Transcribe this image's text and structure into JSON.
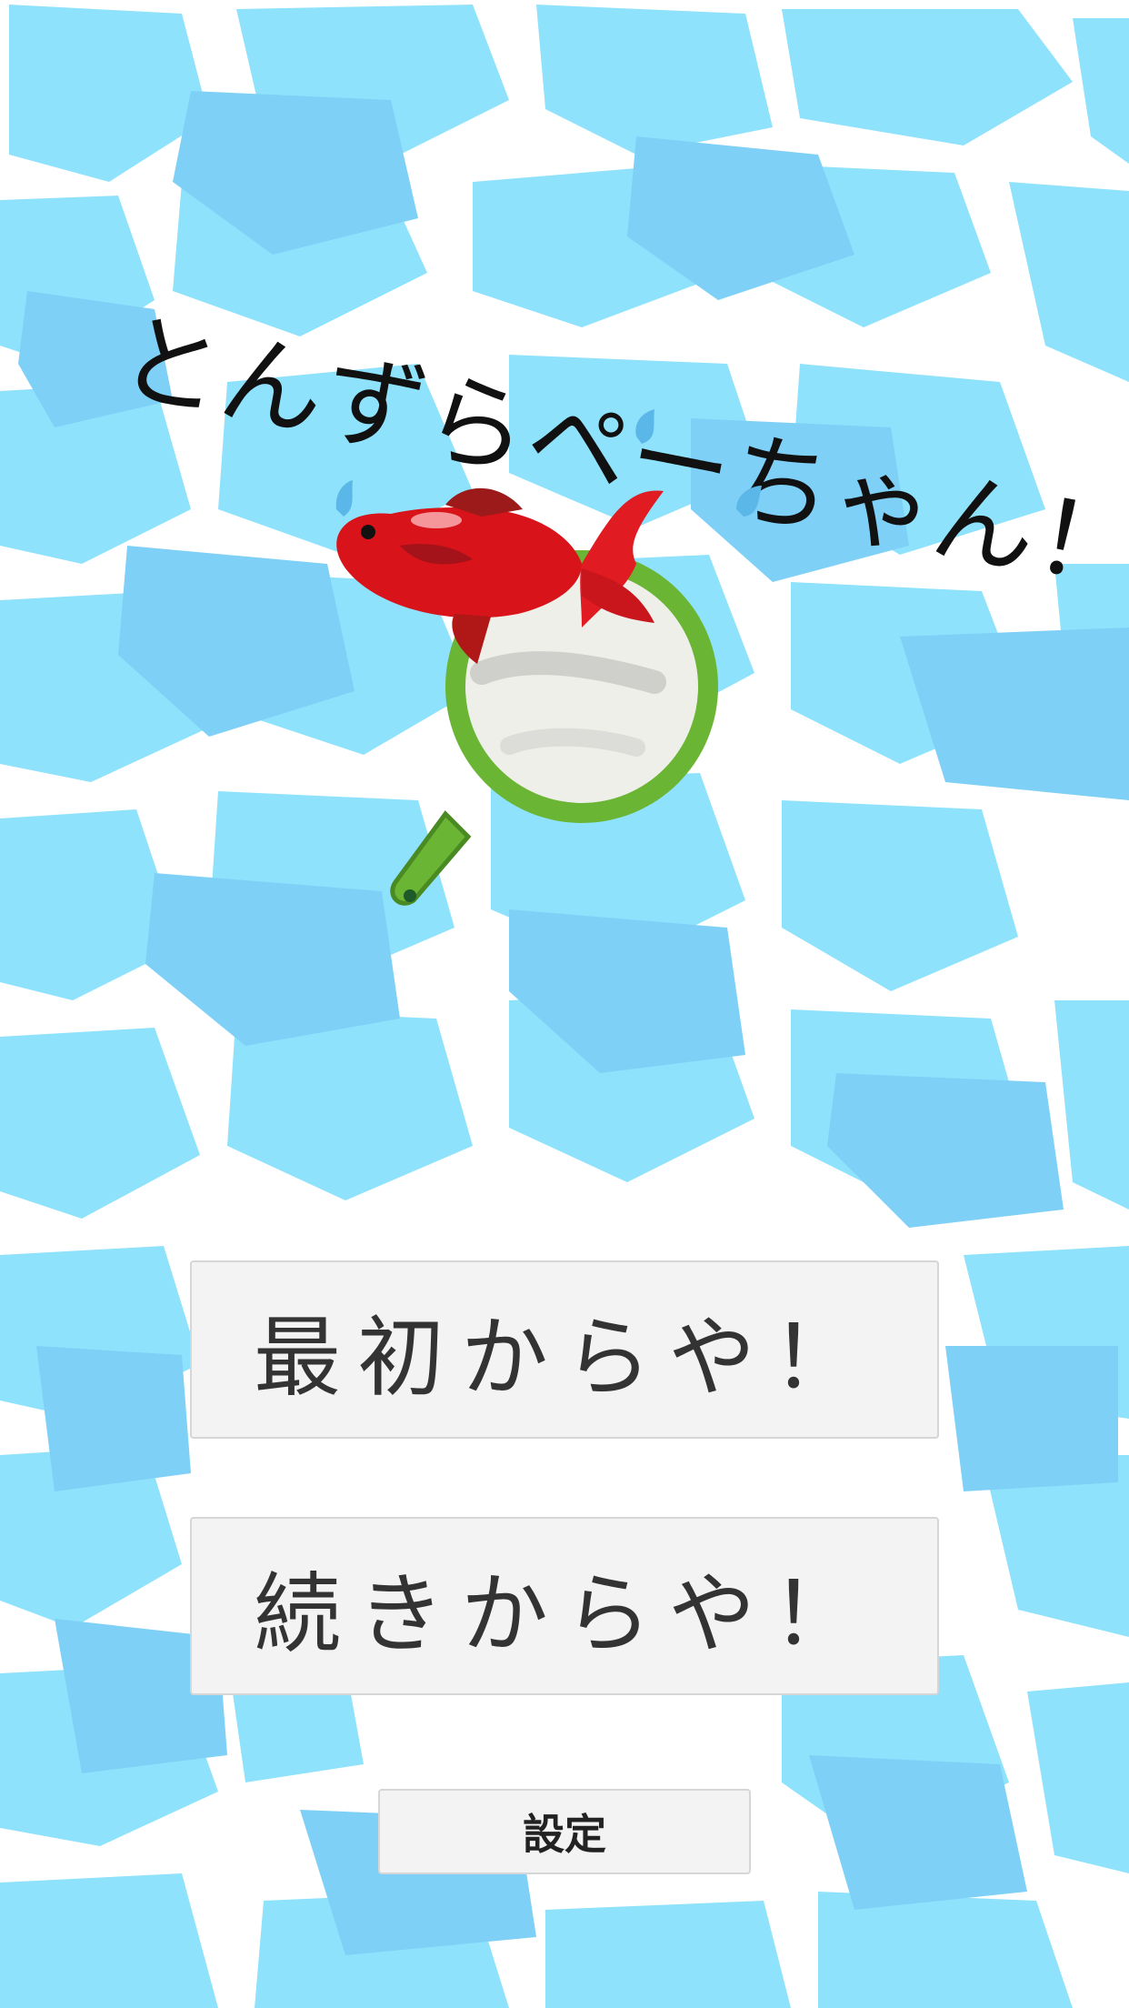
{
  "title": "とんずらペーちゃん！",
  "menu": {
    "start_label": "最初からや！",
    "continue_label": "続きからや！",
    "settings_label": "設定"
  },
  "colors": {
    "water_light": "#8fe2fb",
    "water_dark": "#7fd0f7",
    "grout": "#ffffff",
    "fish_red": "#d8131a",
    "net_green": "#6bb534",
    "button_bg": "#f3f3f3"
  },
  "icons": {
    "fish": "goldfish-icon",
    "net": "scoop-net-icon",
    "drops": "water-drop-icon"
  }
}
